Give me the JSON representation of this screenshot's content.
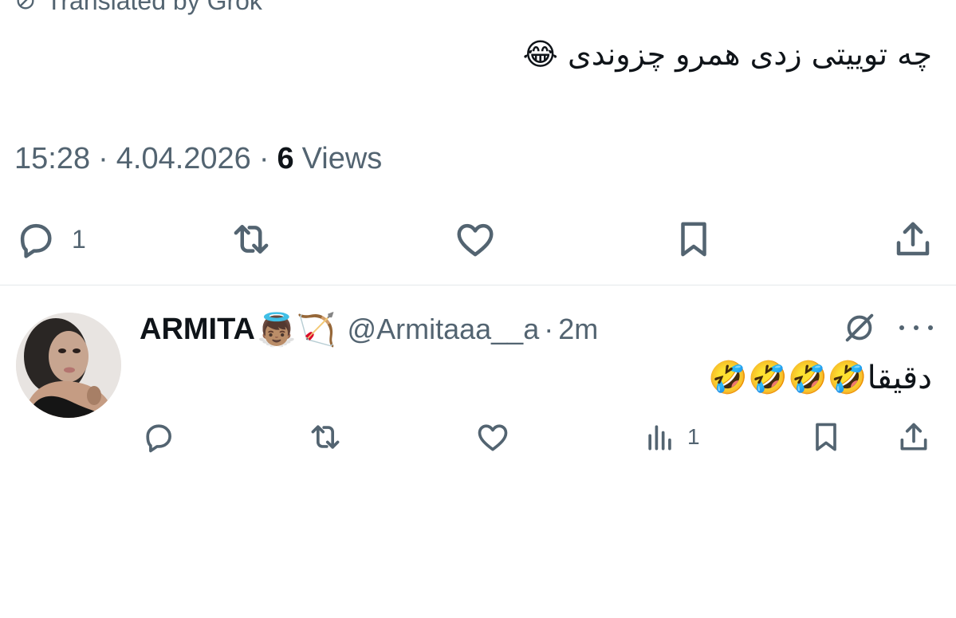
{
  "tweet": {
    "translated_label": "Translated by Grok",
    "text": "چه توییتی زدی همرو چزوندی",
    "text_emoji": "😂",
    "time": "15:28",
    "date": "4.04.2026",
    "separator": "·",
    "views_count": "6",
    "views_label": "Views",
    "actions": {
      "reply_count": "1"
    }
  },
  "reply": {
    "display_name": "ARMITA",
    "name_emojis": "👼🏽🏹",
    "handle": "@Armitaaa__a",
    "separator": "·",
    "time": "2m",
    "text": "دقیقا",
    "text_emojis": "🤣🤣🤣🤣",
    "actions": {
      "views_count": "1"
    }
  },
  "icons": {
    "translate": "translate-icon",
    "reply": "reply-icon",
    "retweet": "retweet-icon",
    "like": "heart-icon",
    "bookmark": "bookmark-icon",
    "share": "share-icon",
    "views": "views-icon",
    "grok": "grok-icon",
    "more": "more-icon"
  },
  "colors": {
    "text": "#0f1419",
    "secondary": "#536471",
    "divider": "#e4e8eb"
  }
}
